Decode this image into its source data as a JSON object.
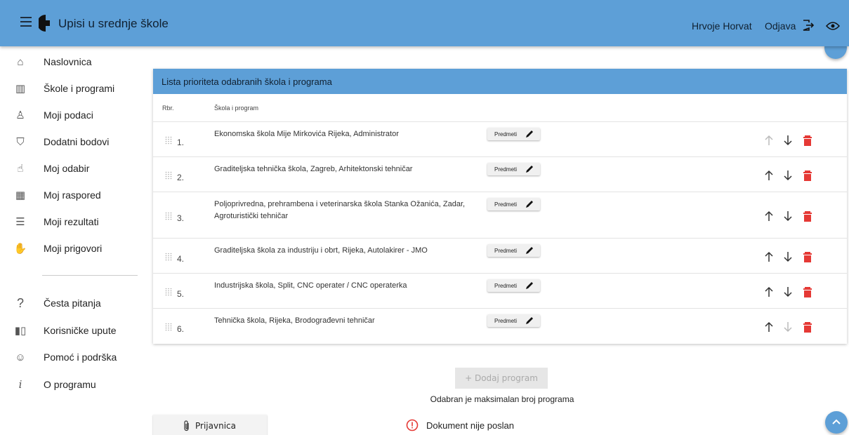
{
  "app": {
    "title": "Upisi u srednje škole"
  },
  "header": {
    "user_name": "Hrvoje Horvat",
    "logout_label": "Odjava"
  },
  "sidebar": {
    "items": [
      {
        "label": "Naslovnica",
        "icon": "home-icon"
      },
      {
        "label": "Škole i programi",
        "icon": "buildings-icon"
      },
      {
        "label": "Moji podaci",
        "icon": "person-icon"
      },
      {
        "label": "Dodatni bodovi",
        "icon": "shield-star-icon"
      },
      {
        "label": "Moj odabir",
        "icon": "hand-pointer-icon"
      },
      {
        "label": "Moj raspored",
        "icon": "calendar-icon"
      },
      {
        "label": "Moji rezultati",
        "icon": "list-icon"
      },
      {
        "label": "Moji prigovori",
        "icon": "raised-hand-icon"
      }
    ],
    "secondary_items": [
      {
        "label": "Česta pitanja",
        "icon": "question-icon"
      },
      {
        "label": "Korisničke upute",
        "icon": "book-icon"
      },
      {
        "label": "Pomoć i podrška",
        "icon": "support-icon"
      },
      {
        "label": "O programu",
        "icon": "info-icon"
      }
    ]
  },
  "main": {
    "card_title": "Lista prioriteta odabranih škola i programa",
    "col_rbr": "Rbr.",
    "col_school": "Škola i program",
    "predmeti_label": "Predmeti",
    "rows": [
      {
        "num": "1.",
        "school": "Ekonomska škola Mije Mirkovića Rijeka, Administrator",
        "up_enabled": false,
        "down_enabled": true
      },
      {
        "num": "2.",
        "school": "Graditeljska tehnička škola, Zagreb, Arhitektonski tehničar",
        "up_enabled": true,
        "down_enabled": true
      },
      {
        "num": "3.",
        "school": "Poljoprivredna, prehrambena i veterinarska škola Stanka Ožanića, Zadar, Agroturistički tehničar",
        "up_enabled": true,
        "down_enabled": true
      },
      {
        "num": "4.",
        "school": "Graditeljska škola za industriju i obrt, Rijeka, Autolakirer - JMO",
        "up_enabled": true,
        "down_enabled": true
      },
      {
        "num": "5.",
        "school": "Industrijska škola, Split, CNC operater / CNC operaterka",
        "up_enabled": true,
        "down_enabled": true
      },
      {
        "num": "6.",
        "school": "Tehnička škola, Rijeka, Brodograđevni tehničar",
        "up_enabled": true,
        "down_enabled": false
      }
    ],
    "add_program_label": "+ Dodaj program",
    "max_note": "Odabran je maksimalan broj programa",
    "prijavnica_label": "Prijavnica",
    "doc_status": "Dokument nije poslan"
  },
  "colors": {
    "accent": "#5d9fd7",
    "delete": "#e53935",
    "warning": "#e53935"
  }
}
